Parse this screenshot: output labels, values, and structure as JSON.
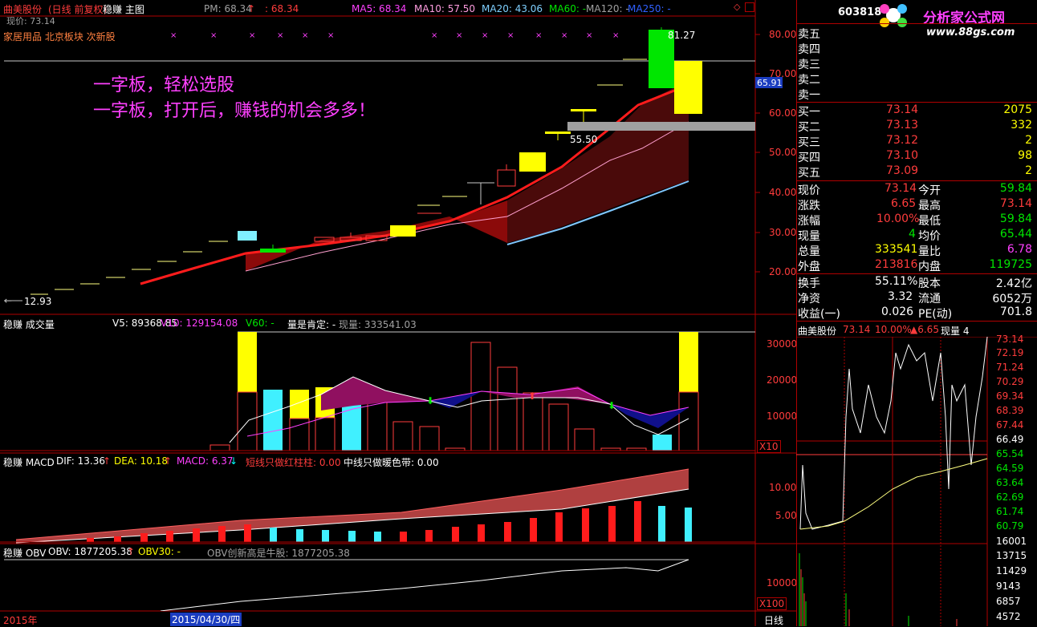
{
  "header": {
    "stock_name": "曲美股份",
    "mode": "(日线 前复权)",
    "indicator": "稳赚 主图",
    "pm_label": "PM: 68.34",
    "pm_arrow": "↑",
    "pm_value": ": 68.34",
    "ma5": "MA5: 68.34",
    "ma10": "MA10: 57.50",
    "ma20": "MA20: 43.06",
    "ma60": "MA60: -",
    "ma120": "MA120: -",
    "ma250": "MA250: -",
    "price_now": "现价: 73.14",
    "sector": "家居用品 北京板块 次新股"
  },
  "annotations": {
    "line1": "一字板，轻松选股",
    "line2": "一字板，打开后，赚钱的机会多多！",
    "high": "81.27",
    "mark": "55.50",
    "low": "12.93",
    "price_tag": "65.91"
  },
  "price_axis": [
    "80.00",
    "70.00",
    "60.00",
    "50.00",
    "40.00",
    "30.00",
    "20.00"
  ],
  "vol_panel": {
    "title": "稳赚 成交量",
    "v5": "V5: 89368.85",
    "v10": "V10: 129154.08",
    "v60": "V60: -",
    "note": "量是肯定: -",
    "now": "现量: 333541.03",
    "axis": [
      "30000",
      "20000",
      "10000"
    ],
    "unit": "X10"
  },
  "macd_panel": {
    "title": "稳赚 MACD",
    "dif": "DIF: 13.36",
    "dea": "DEA: 10.18",
    "macd": "MACD: 6.37",
    "note1": "短线只做红柱柱: 0.00",
    "note2": "中线只做暖色带: 0.00",
    "axis": [
      "10.00",
      "5.00"
    ]
  },
  "obv_panel": {
    "title": "稳赚 OBV",
    "obv": "OBV: 1877205.38",
    "obv30": "OBV30: -",
    "note": "OBV创新高是牛股: 1877205.38",
    "axis": [
      "10000"
    ],
    "unit": "X100"
  },
  "timeline": {
    "year": "2015年",
    "date": "2015/04/30/四",
    "period": "日线"
  },
  "quote": {
    "code": "603818",
    "logo_text": "分析家公式网",
    "logo_url": "www.88gs.com",
    "sell": [
      {
        "label": "卖五",
        "price": "",
        "vol": ""
      },
      {
        "label": "卖四",
        "price": "",
        "vol": ""
      },
      {
        "label": "卖三",
        "price": "",
        "vol": ""
      },
      {
        "label": "卖二",
        "price": "",
        "vol": ""
      },
      {
        "label": "卖一",
        "price": "",
        "vol": ""
      }
    ],
    "buy": [
      {
        "label": "买一",
        "price": "73.14",
        "vol": "2075"
      },
      {
        "label": "买二",
        "price": "73.13",
        "vol": "332"
      },
      {
        "label": "买三",
        "price": "73.12",
        "vol": "2"
      },
      {
        "label": "买四",
        "price": "73.10",
        "vol": "98"
      },
      {
        "label": "买五",
        "price": "73.09",
        "vol": "2"
      }
    ],
    "stats": [
      {
        "l1": "现价",
        "v1": "73.14",
        "l2": "今开",
        "v2": "59.84"
      },
      {
        "l1": "涨跌",
        "v1": "6.65",
        "l2": "最高",
        "v2": "73.14"
      },
      {
        "l1": "涨幅",
        "v1": "10.00%",
        "l2": "最低",
        "v2": "59.84"
      },
      {
        "l1": "现量",
        "v1": "4",
        "l2": "均价",
        "v2": "65.44"
      },
      {
        "l1": "总量",
        "v1": "333541",
        "l2": "量比",
        "v2": "6.78"
      },
      {
        "l1": "外盘",
        "v1": "213816",
        "l2": "内盘",
        "v2": "119725"
      }
    ],
    "fund": [
      {
        "l1": "换手",
        "v1": "55.11%",
        "l2": "股本",
        "v2": "2.42亿"
      },
      {
        "l1": "净资",
        "v1": "3.32",
        "l2": "流通",
        "v2": "6052万"
      },
      {
        "l1": "收益(一)",
        "v1": "0.026",
        "l2": "PE(动)",
        "v2": "701.8"
      }
    ]
  },
  "intraday": {
    "name": "曲美股份",
    "price": "73.14",
    "pct": "10.00%",
    "chg": "▲6.65",
    "now": "现量 4",
    "axis": [
      "73.14",
      "72.19",
      "71.24",
      "70.29",
      "69.34",
      "68.39",
      "67.44",
      "66.49",
      "65.54",
      "64.59",
      "63.64",
      "62.69",
      "61.74",
      "60.79",
      "16001",
      "13715",
      "11429",
      "9143",
      "6857",
      "4572"
    ]
  },
  "colors": {
    "up": "#ff3c3c",
    "down": "#00e600",
    "panel_border": "#b00000",
    "accent": "#ff40ff"
  }
}
